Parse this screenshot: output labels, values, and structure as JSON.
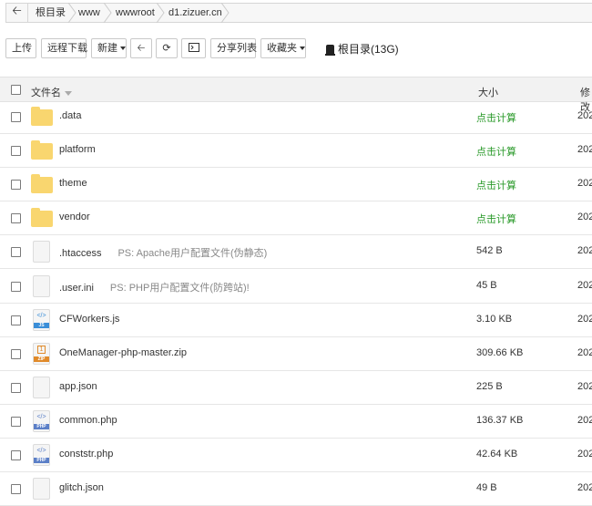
{
  "breadcrumb": [
    "根目录",
    "www",
    "wwwroot",
    "d1.zizuer.cn"
  ],
  "toolbar": {
    "upload": "上传",
    "remote_download": "远程下载",
    "new": "新建",
    "share_list": "分享列表",
    "favorites": "收藏夹",
    "root_label": "根目录(13G)"
  },
  "table": {
    "col_name": "文件名",
    "col_size": "大小",
    "col_modified": "修改"
  },
  "rows": [
    {
      "name": ".data",
      "note": "",
      "size": "点击计算",
      "date": "202",
      "type": "folder"
    },
    {
      "name": "platform",
      "note": "",
      "size": "点击计算",
      "date": "202",
      "type": "folder"
    },
    {
      "name": "theme",
      "note": "",
      "size": "点击计算",
      "date": "202",
      "type": "folder"
    },
    {
      "name": "vendor",
      "note": "",
      "size": "点击计算",
      "date": "202",
      "type": "folder"
    },
    {
      "name": ".htaccess",
      "note": "PS: Apache用户配置文件(伪静态)",
      "size": "542 B",
      "date": "202",
      "type": "file"
    },
    {
      "name": ".user.ini",
      "note": "PS: PHP用户配置文件(防跨站)!",
      "size": "45 B",
      "date": "202",
      "type": "file"
    },
    {
      "name": "CFWorkers.js",
      "note": "",
      "size": "3.10 KB",
      "date": "202",
      "type": "js"
    },
    {
      "name": "OneManager-php-master.zip",
      "note": "",
      "size": "309.66 KB",
      "date": "202",
      "type": "zip"
    },
    {
      "name": "app.json",
      "note": "",
      "size": "225 B",
      "date": "202",
      "type": "file"
    },
    {
      "name": "common.php",
      "note": "",
      "size": "136.37 KB",
      "date": "202",
      "type": "php"
    },
    {
      "name": "conststr.php",
      "note": "",
      "size": "42.64 KB",
      "date": "202",
      "type": "php"
    },
    {
      "name": "glitch.json",
      "note": "",
      "size": "49 B",
      "date": "202",
      "type": "file"
    }
  ]
}
